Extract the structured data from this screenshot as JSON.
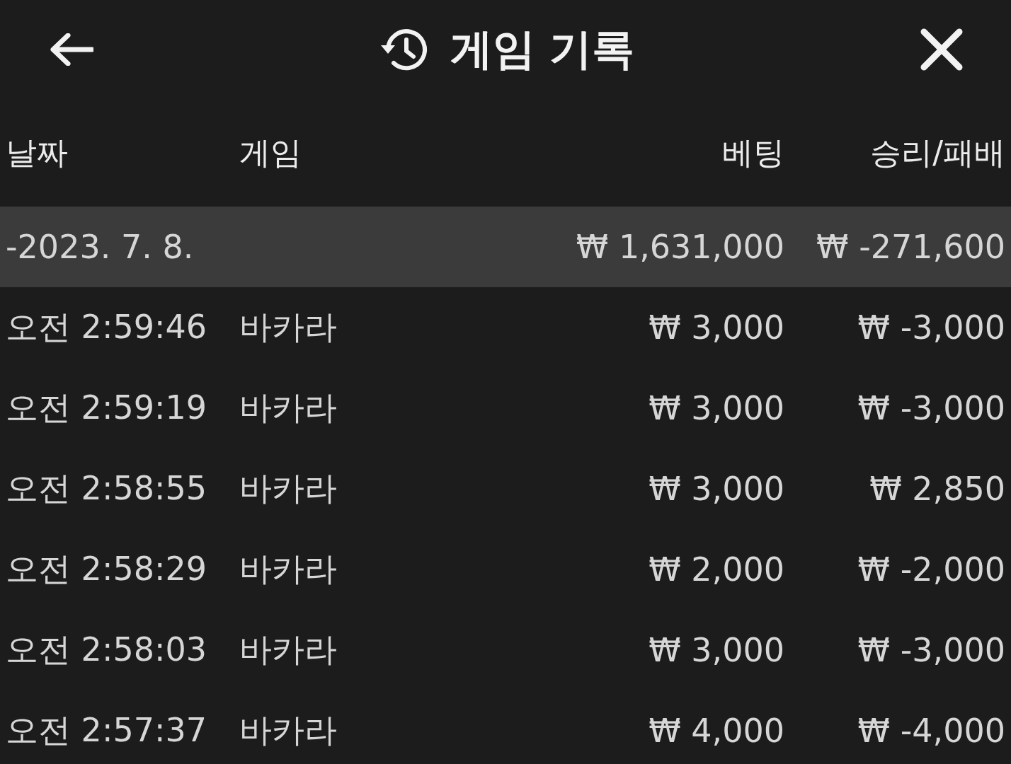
{
  "header": {
    "title": "게임 기록"
  },
  "columns": [
    "날짜",
    "게임",
    "베팅",
    "승리/패배"
  ],
  "date_group": {
    "date": "-2023. 7. 8.",
    "bet": "₩ 1,631,000",
    "result": "₩ -271,600"
  },
  "rows": [
    {
      "time": "오전 2:59:46",
      "game": "바카라",
      "bet": "₩ 3,000",
      "result": "₩ -3,000"
    },
    {
      "time": "오전 2:59:19",
      "game": "바카라",
      "bet": "₩ 3,000",
      "result": "₩ -3,000"
    },
    {
      "time": "오전 2:58:55",
      "game": "바카라",
      "bet": "₩ 3,000",
      "result": "₩ 2,850"
    },
    {
      "time": "오전 2:58:29",
      "game": "바카라",
      "bet": "₩ 2,000",
      "result": "₩ -2,000"
    },
    {
      "time": "오전 2:58:03",
      "game": "바카라",
      "bet": "₩ 3,000",
      "result": "₩ -3,000"
    },
    {
      "time": "오전 2:57:37",
      "game": "바카라",
      "bet": "₩ 4,000",
      "result": "₩ -4,000"
    }
  ]
}
